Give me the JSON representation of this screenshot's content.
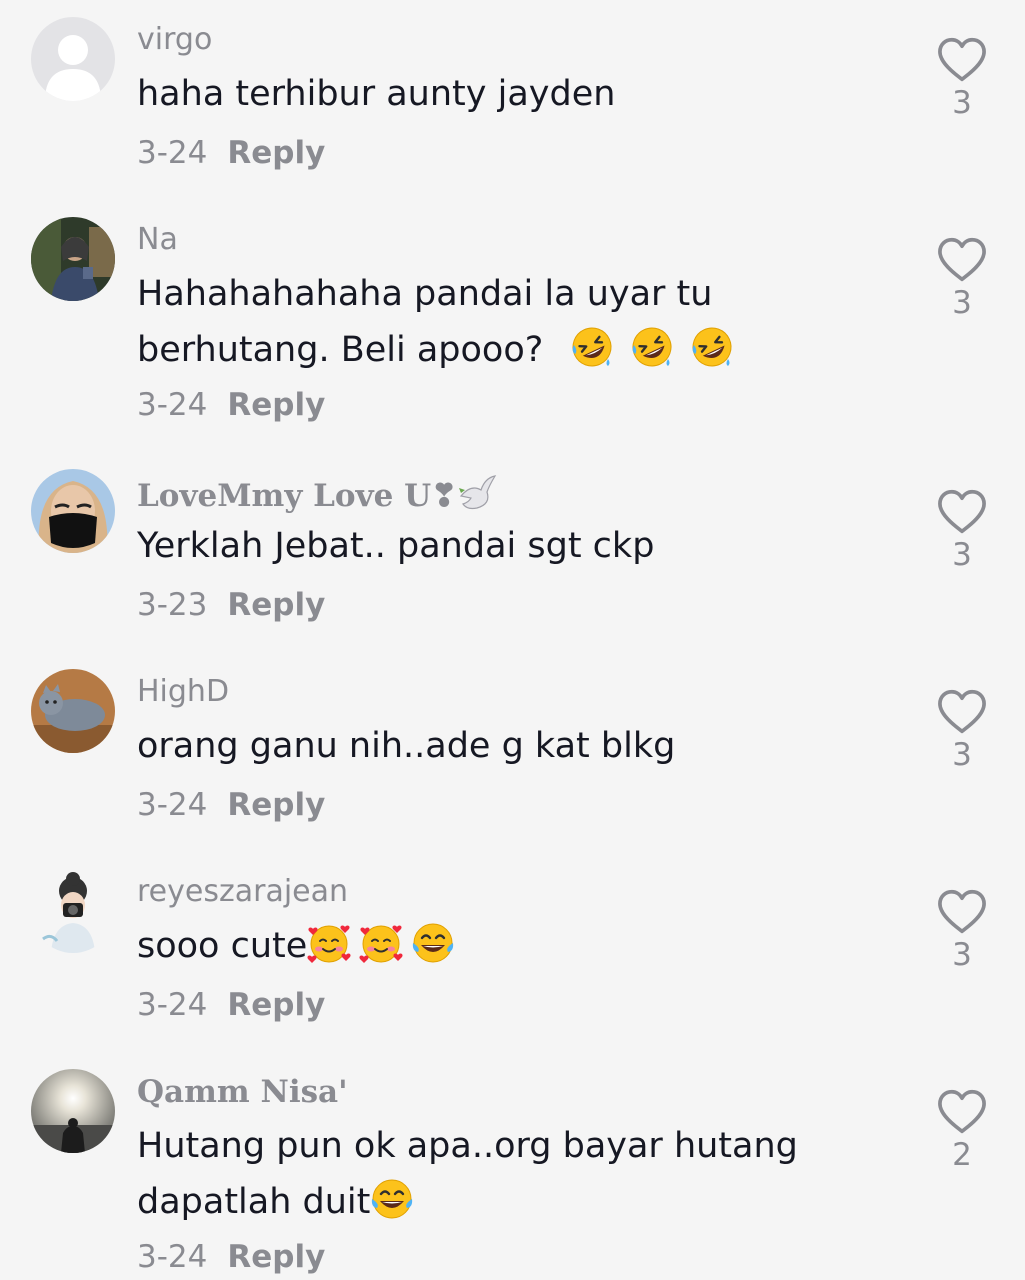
{
  "comments": [
    {
      "username": "virgo",
      "text": "haha terhibur aunty jayden",
      "date": "3-24",
      "reply_label": "Reply",
      "likes": "3"
    },
    {
      "username": "Na",
      "text_line1": "Hahahahahaha pandai la uyar tu",
      "text_line2": "berhutang. Beli apooo?",
      "date": "3-24",
      "reply_label": "Reply",
      "likes": "3"
    },
    {
      "username": "LoveMmy Love U❣",
      "text": "Yerklah Jebat.. pandai sgt ckp",
      "date": "3-23",
      "reply_label": "Reply",
      "likes": "3"
    },
    {
      "username": "HighD",
      "text": "orang ganu nih..ade g kat blkg",
      "date": "3-24",
      "reply_label": "Reply",
      "likes": "3"
    },
    {
      "username": "reyeszarajean",
      "text": "sooo cute",
      "date": "3-24",
      "reply_label": "Reply",
      "likes": "3"
    },
    {
      "username": "Qamm Nisa'",
      "text_line1": "Hutang pun ok apa..org bayar hutang",
      "text_line2": "dapatlah duit",
      "date": "3-24",
      "reply_label": "Reply",
      "likes": "2"
    }
  ],
  "icons": {
    "like": "heart-outline-icon",
    "emoji_rofl": "rolling-on-floor-laughing-emoji",
    "emoji_hearts": "smiling-face-with-hearts-emoji",
    "emoji_joy": "face-with-tears-of-joy-emoji"
  },
  "colors": {
    "background": "#f5f5f5",
    "text_primary": "#161823",
    "text_secondary": "#8a8b91"
  }
}
